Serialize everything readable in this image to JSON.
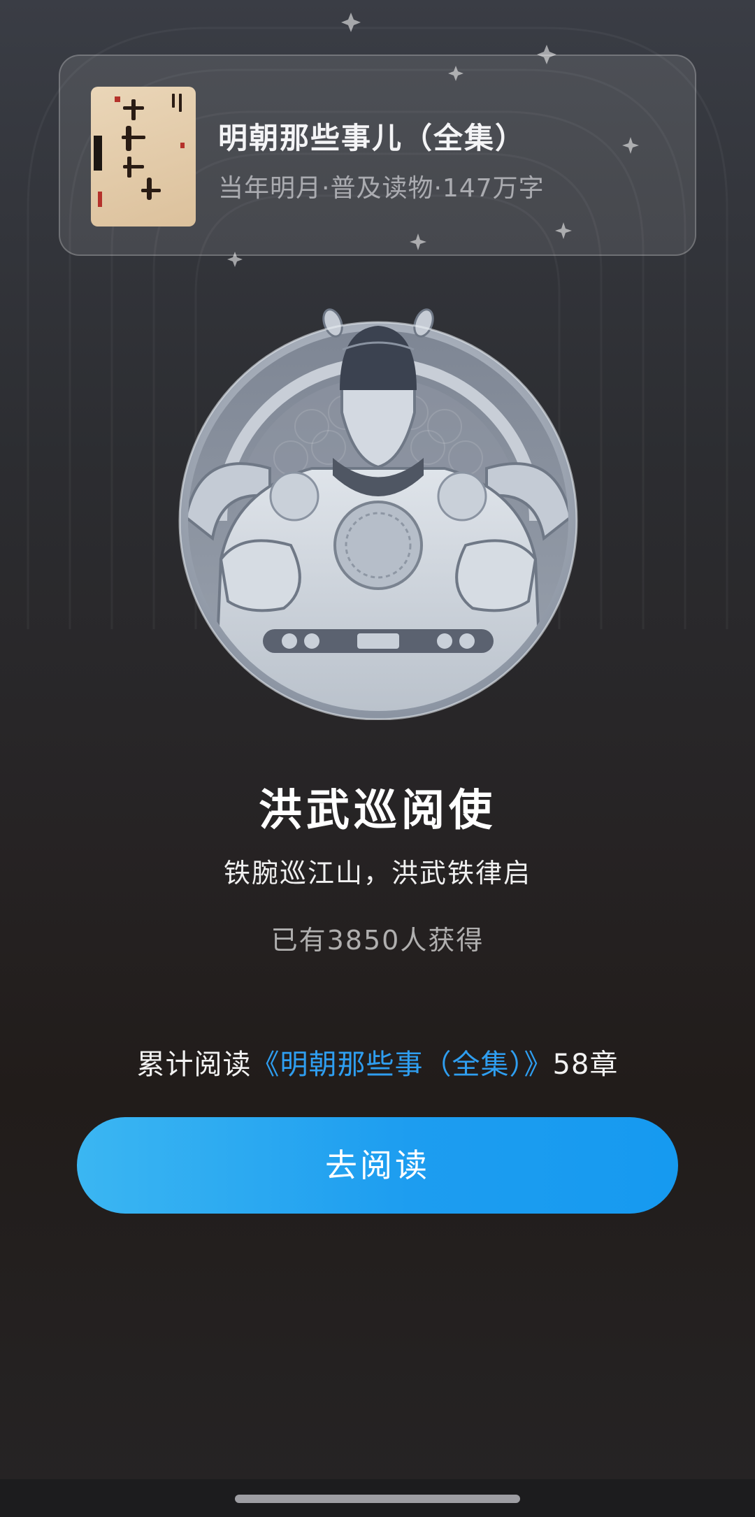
{
  "book": {
    "title": "明朝那些事儿（全集）",
    "meta": "当年明月·普及读物·147万字",
    "cover_icon": "book-cover-image"
  },
  "medal": {
    "icon": "ming-emperor-medal-icon",
    "title": "洪武巡阅使",
    "description": "铁腕巡江山，洪武铁律启",
    "earned_count": "已有3850人获得"
  },
  "progress": {
    "prefix": "累计阅读",
    "book_link": "《明朝那些事（全集）》",
    "suffix": "58章"
  },
  "action": {
    "go_read_label": "去阅读"
  },
  "colors": {
    "accent": "#1d9df0",
    "link": "#2f9ef0",
    "background_top": "#3a3d45",
    "background_bottom": "#211c1a"
  }
}
